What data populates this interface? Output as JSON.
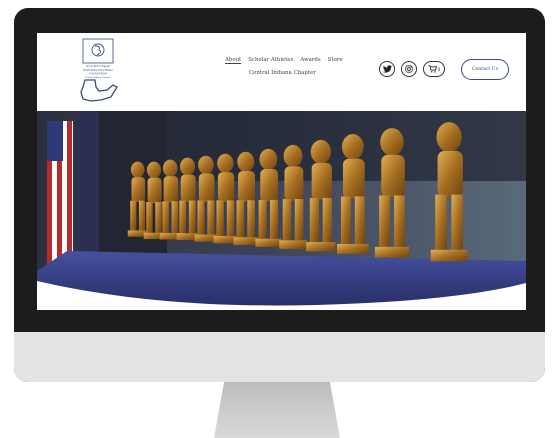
{
  "logo": {
    "line1": "Circle Bowl Chapter",
    "line2": "NATIONAL FOOTBALL",
    "line3": "FOUNDATION",
    "line4": "Central Indiana Chapter"
  },
  "nav": {
    "items": [
      {
        "label": "About",
        "active": true
      },
      {
        "label": "Scholar Athletes",
        "active": false
      },
      {
        "label": "Awards",
        "active": false
      },
      {
        "label": "Store",
        "active": false
      }
    ],
    "secondary": "Central Indiana Chapter"
  },
  "social": {
    "icons": [
      "twitter-icon",
      "instagram-icon",
      "cart-icon"
    ],
    "cart_count": "0"
  },
  "contact": {
    "label": "Contact Us"
  },
  "colors": {
    "accent": "#3b4a7a",
    "frame": "#1c1c1c",
    "chin": "#e4e4e4",
    "table": "#3a4485",
    "gold": "#b8862c"
  }
}
